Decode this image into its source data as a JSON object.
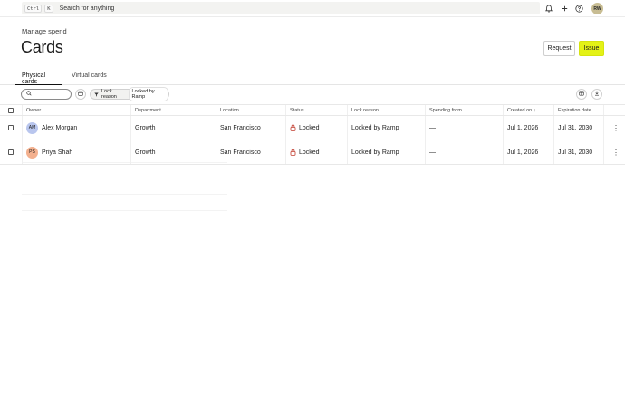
{
  "topbar": {
    "kbd_ctrl": "Ctrl",
    "kbd_k": "K",
    "search_placeholder": "Search for anything",
    "user_initials": "RW"
  },
  "header": {
    "breadcrumb": "Manage spend",
    "title": "Cards",
    "request_label": "Request",
    "issue_label": "Issue",
    "accent_color": "#e4f216"
  },
  "tabs": [
    {
      "label": "Physical cards",
      "active": true
    },
    {
      "label": "Virtual cards",
      "active": false
    }
  ],
  "filters": {
    "chip_key": "Lock reason",
    "chip_value": "Locked by Ramp"
  },
  "table": {
    "columns": [
      "Owner",
      "Department",
      "Location",
      "Status",
      "Lock reason",
      "Spending from",
      "Created on",
      "Expiration date"
    ],
    "sort_indicator": "↓",
    "rows": [
      {
        "initials": "AM",
        "avatar_color": "#b9c6ee",
        "owner": "Alex Morgan",
        "department": "Growth",
        "location": "San Francisco",
        "status": "Locked",
        "lock_reason": "Locked by Ramp",
        "spending_from": "—",
        "created_on": "Jul 1, 2026",
        "expiration": "Jul 31, 2030"
      },
      {
        "initials": "PS",
        "avatar_color": "#f3b08e",
        "owner": "Priya Shah",
        "department": "Growth",
        "location": "San Francisco",
        "status": "Locked",
        "lock_reason": "Locked by Ramp",
        "spending_from": "—",
        "created_on": "Jul 1, 2026",
        "expiration": "Jul 31, 2030"
      }
    ]
  }
}
